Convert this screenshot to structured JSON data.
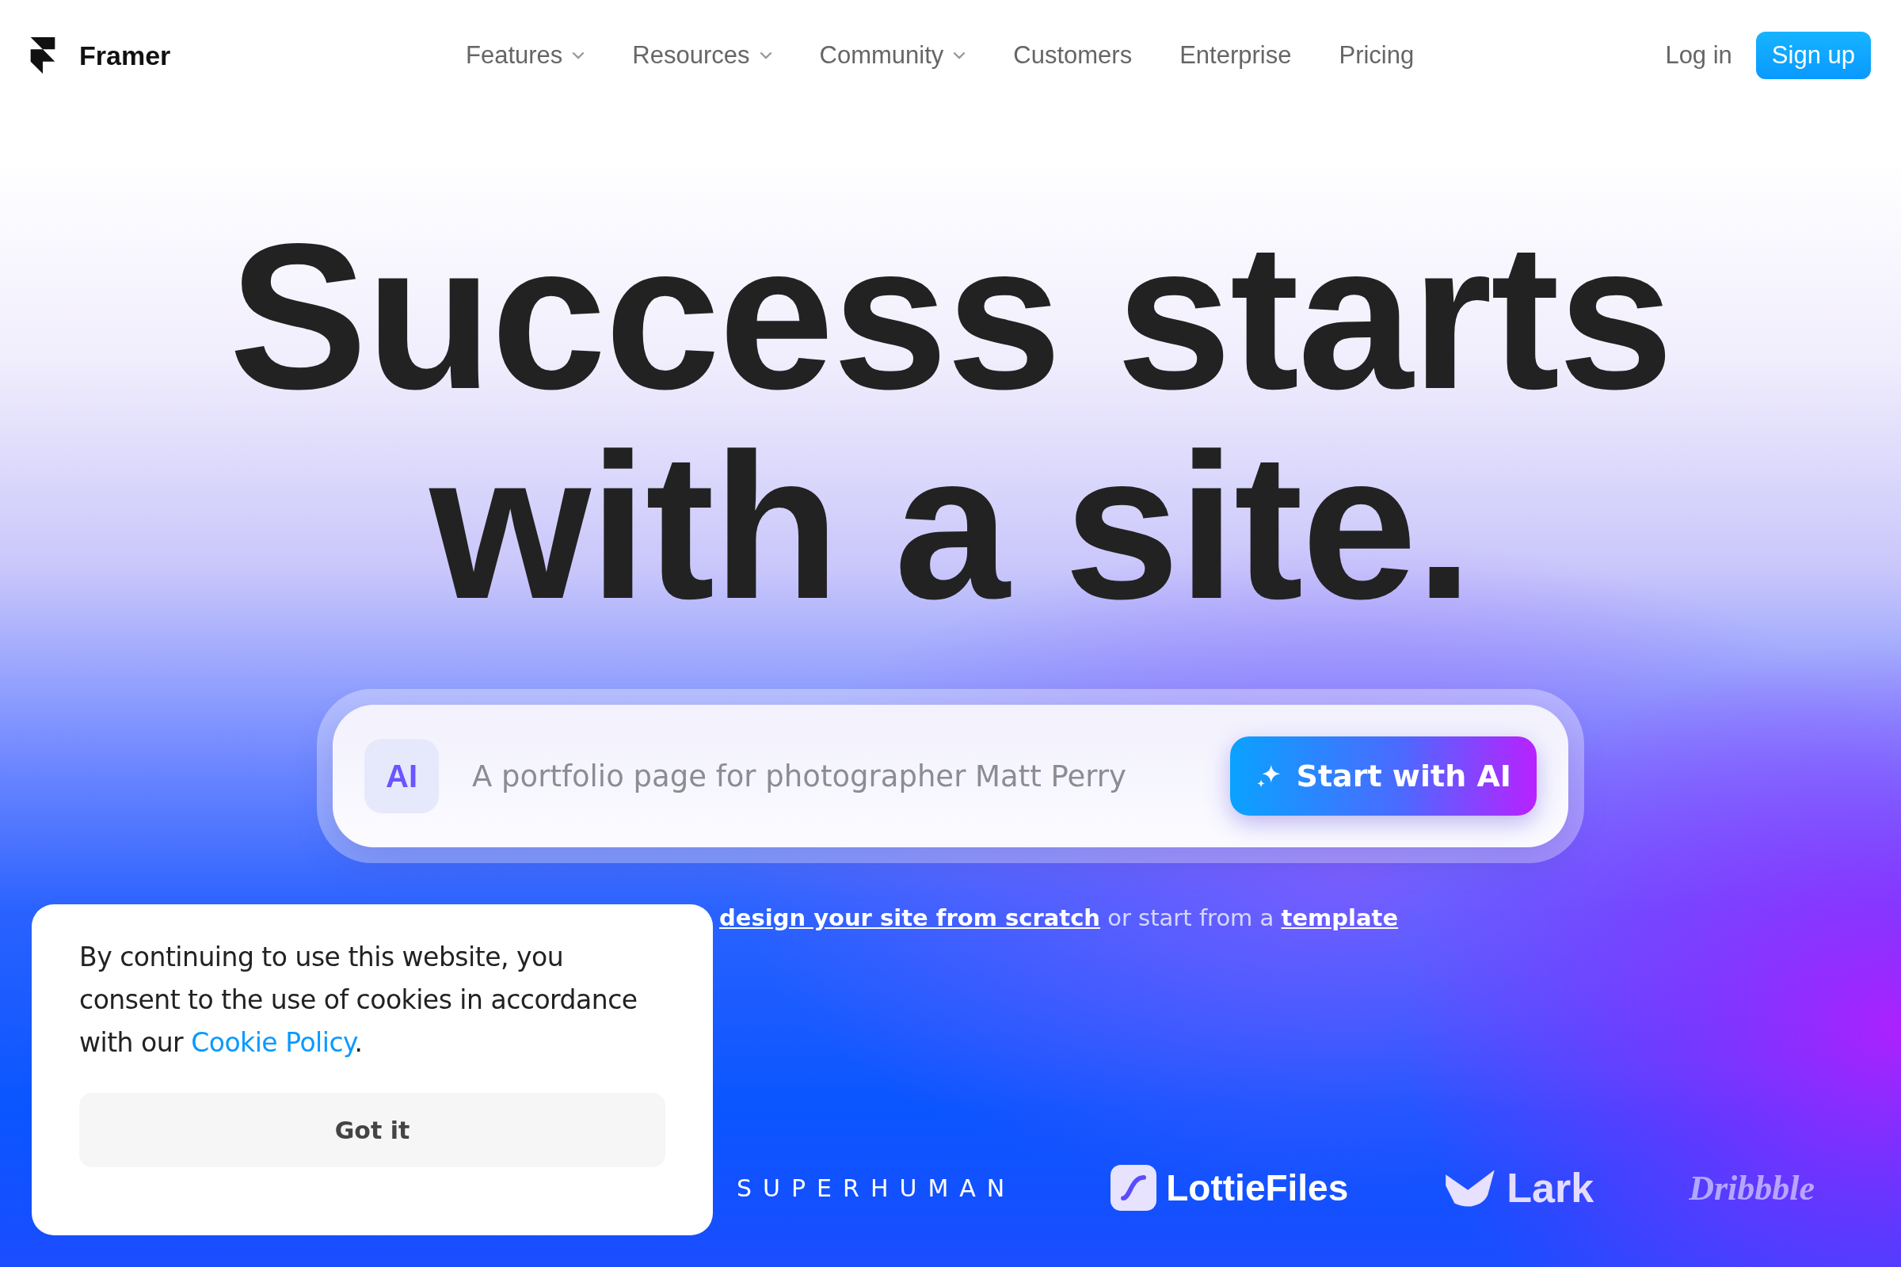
{
  "brand": {
    "name": "Framer"
  },
  "nav": [
    {
      "label": "Features",
      "has_menu": true
    },
    {
      "label": "Resources",
      "has_menu": true
    },
    {
      "label": "Community",
      "has_menu": true
    },
    {
      "label": "Customers",
      "has_menu": false
    },
    {
      "label": "Enterprise",
      "has_menu": false
    },
    {
      "label": "Pricing",
      "has_menu": false
    }
  ],
  "login": "Log in",
  "signup": "Sign up",
  "headline": [
    "Success starts",
    "with a site."
  ],
  "prompt": {
    "badge": "AI",
    "placeholder": "A portfolio page for photographer Matt Perry",
    "button": "Start with AI"
  },
  "alt_start": {
    "link_1": "design your site from scratch",
    "middle": "or start from a",
    "link_2": "template"
  },
  "logos": [
    {
      "kind": "wordmark",
      "label": "SUPERHUMAN"
    },
    {
      "kind": "lottie",
      "label": "LottieFiles"
    },
    {
      "kind": "lark",
      "label": "Lark"
    },
    {
      "kind": "script",
      "label": "Dribbble"
    }
  ],
  "cookie": {
    "before": "By continuing to use this website, you consent to the use of cookies in accordance with our ",
    "link": "Cookie Policy",
    "after": ".",
    "button": "Got it"
  }
}
